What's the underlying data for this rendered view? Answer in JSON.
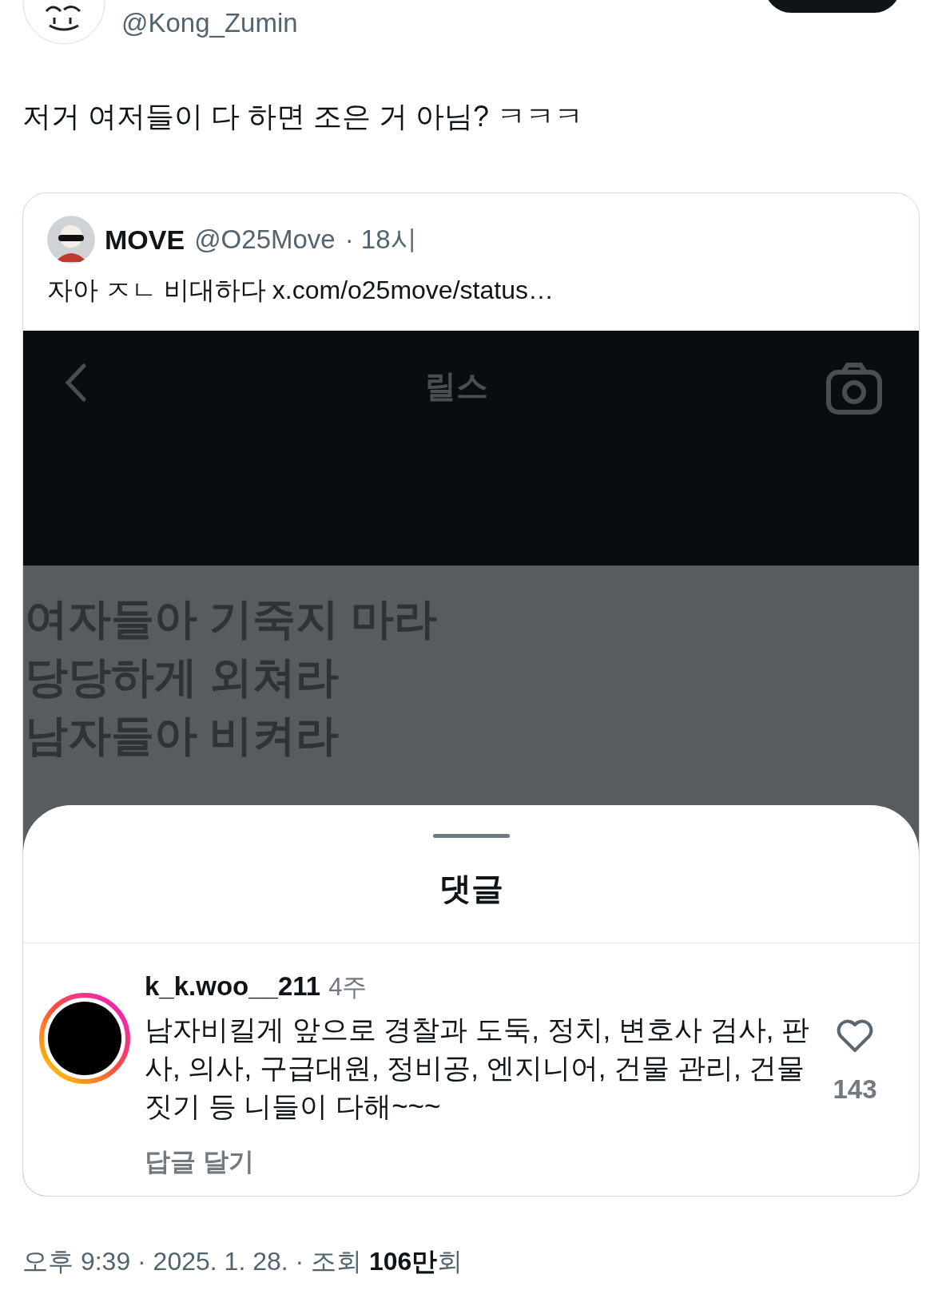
{
  "author": {
    "handle": "@Kong_Zumin"
  },
  "tweet_text": "저거 여저들이 다 하면 조은 거 아님? ㅋㅋㅋ",
  "quote": {
    "name": "MOVE",
    "handle": "@O25Move",
    "time": "· 18시",
    "text": "자아 ㅈㄴ 비대하다",
    "link": "x.com/o25move/status…",
    "image": {
      "header_title": "릴스",
      "lyrics": [
        "여자들아 기죽지 마라",
        "당당하게 외쳐라",
        "남자들아 비켜라"
      ],
      "sheet": {
        "title": "댓글",
        "comments": [
          {
            "username": "k_k.woo__211",
            "time": "4주",
            "text": "남자비킬게 앞으로 경찰과 도둑, 정치, 변호사 검사, 판사, 의사, 구급대원, 정비공, 엔지니어, 건물 관리, 건물짓기 등 니들이 다해~~~",
            "likes": "143",
            "liked": false,
            "reply": "답글 달기"
          }
        ]
      }
    }
  },
  "footer": "오후 9:39 · 2025. 1. 28. · 조회 **106만**회"
}
